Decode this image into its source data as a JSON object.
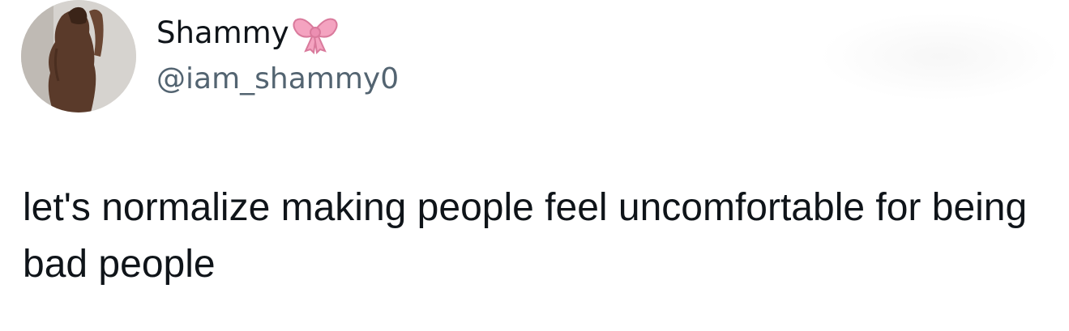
{
  "tweet": {
    "author": {
      "display_name": "Shammy",
      "name_emoji_icon": "ribbon-bow-icon",
      "handle": "@iam_shammy0",
      "avatar": "profile-photo"
    },
    "text": "let's normalize making people feel uncomfortable for being bad people"
  },
  "colors": {
    "text_primary": "#0f1419",
    "text_secondary": "#536471",
    "bow_pink": "#f4a3c0"
  }
}
